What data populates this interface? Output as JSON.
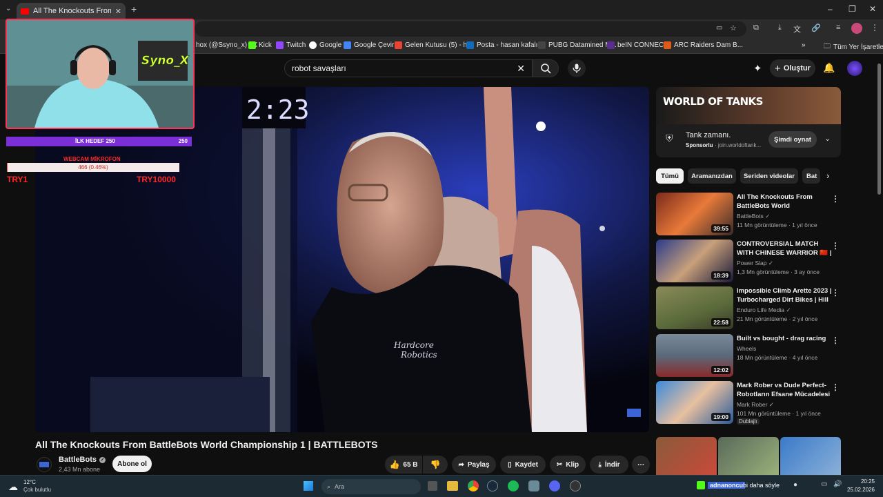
{
  "browser": {
    "tab_title": "All The Knockouts From BattleBots",
    "bookmarks": [
      {
        "label": "hox (@Ssyno_x) / X"
      },
      {
        "label": "Kick"
      },
      {
        "label": "Twitch"
      },
      {
        "label": "Google"
      },
      {
        "label": "Google Çeviri"
      },
      {
        "label": "Gelen Kutusu (5) - h..."
      },
      {
        "label": "Posta - hasan kafalı..."
      },
      {
        "label": "PUBG Datamined M..."
      },
      {
        "label": "beIN CONNECT"
      },
      {
        "label": "ARC Raiders Dam B..."
      }
    ],
    "all_bookmarks": "Tüm Yer İşaretleri"
  },
  "youtube": {
    "search_value": "robot savaşları",
    "create_label": "Oluştur"
  },
  "overlay": {
    "cam_name": "Syno_X",
    "goal_label": "İLK HEDEF 250",
    "goal_value": "250",
    "webcam_label": "WEBCAM MİKROFON",
    "donation_progress_text": "466 (0.46%)",
    "donation_progress": 0.0046,
    "try_start": "TRY1",
    "try_end": "TRY10000"
  },
  "video": {
    "timer": "2:23",
    "shirt_line1": "Hardcore",
    "shirt_line2": "Robotics",
    "title": "All The Knockouts From BattleBots World Championship 1 | BATTLEBOTS",
    "channel": "BattleBots",
    "subscribers": "2,43 Mn abone",
    "subscribe_label": "Abone ol",
    "likes": "65 B",
    "share": "Paylaş",
    "save": "Kaydet",
    "clip": "Klip",
    "download": "İndir"
  },
  "ad": {
    "brand": "WORLD OF TANKS",
    "title": "Tank zamanı.",
    "sponsored": "Sponsorlu",
    "domain": "· join.worldoftank...",
    "cta": "Şimdi oynat"
  },
  "chips": [
    "Tümü",
    "Aramanızdan",
    "Seriden videolar",
    "Bat"
  ],
  "recommendations": [
    {
      "title": "All The Knockouts From BattleBots World Championshi...",
      "channel": "BattleBots",
      "meta": "11 Mn görüntüleme · 1 yıl önce",
      "duration": "39:55",
      "color": "#6b2a1a"
    },
    {
      "title": "CONTROVERSIAL MATCH WITH CHINESE WARRIOR 🇨🇳 | Powe...",
      "channel": "Power Slap",
      "meta": "1,3 Mn görüntüleme · 3 ay önce",
      "duration": "18:39",
      "color": "#1c2a6a"
    },
    {
      "title": "Impossible Climb Arette 2023 | Turbocharged Dirt Bikes | Hill ...",
      "channel": "Enduro Life Media",
      "meta": "21 Mn görüntüleme · 2 yıl önce",
      "duration": "22:58",
      "color": "#6a6a3a"
    },
    {
      "title": "Built vs bought - drag racing",
      "channel": "Wheels",
      "meta": "18 Mn görüntüleme · 4 yıl önce",
      "duration": "12:02",
      "color": "#4a5a6a"
    },
    {
      "title": "Mark Rober vs Dude Perfect- Robotların Efsane Mücadelesi",
      "channel": "Mark Rober",
      "meta": "101 Mn görüntüleme · 1 yıl önce",
      "duration": "19:00",
      "color": "#2a6aaa",
      "badge": "Dublajlı"
    }
  ],
  "taskbar": {
    "temp": "12°C",
    "weather": "Çok bulutlu",
    "search_placeholder": "Ara",
    "notif_user": "adnanoncu",
    "notif_text": "bi daha söyle",
    "time": "20:25",
    "date": "25.02.2026"
  },
  "colors": {
    "yt_red": "#ff0000",
    "overlay_border": "#ff3355",
    "goal_purple": "#7b2fd6"
  }
}
